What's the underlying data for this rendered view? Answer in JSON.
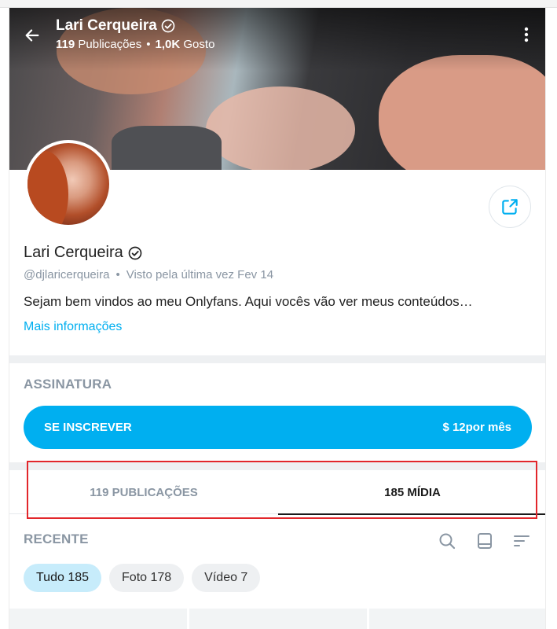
{
  "header": {
    "name": "Lari Cerqueira",
    "posts_count": "119",
    "posts_label": "Publicações",
    "separator": "•",
    "likes_count": "1,0K",
    "likes_label": "Gosto",
    "icons": {
      "back": "arrow-left-icon",
      "more": "more-vertical-icon",
      "verified": "verified-badge-icon"
    }
  },
  "profile": {
    "name": "Lari Cerqueira",
    "handle": "@djlaricerqueira",
    "separator": "•",
    "last_seen": "Visto pela última vez Fev 14",
    "bio": "Sejam bem vindos ao meu Onlyfans. Aqui vocês vão ver meus conteúdos…",
    "more_info": "Mais informações",
    "share_icon": "share-icon"
  },
  "subscription": {
    "section_label": "ASSINATURA",
    "button_label": "SE INSCREVER",
    "price": "$ 12por mês"
  },
  "tabs": [
    {
      "label": "119 PUBLICAÇÕES",
      "active": false
    },
    {
      "label": "185 MÍDIA",
      "active": true
    }
  ],
  "media": {
    "section_label": "RECENTE",
    "tools": [
      "search-icon",
      "grid-layout-icon",
      "sort-icon"
    ],
    "filters": [
      {
        "label": "Tudo 185",
        "active": true
      },
      {
        "label": "Foto 178",
        "active": false
      },
      {
        "label": "Vídeo 7",
        "active": false
      }
    ]
  },
  "colors": {
    "accent": "#00aff0",
    "highlight_box": "#e2262b",
    "muted_text": "#8a96a3",
    "active_chip": "#c7ecfb"
  }
}
